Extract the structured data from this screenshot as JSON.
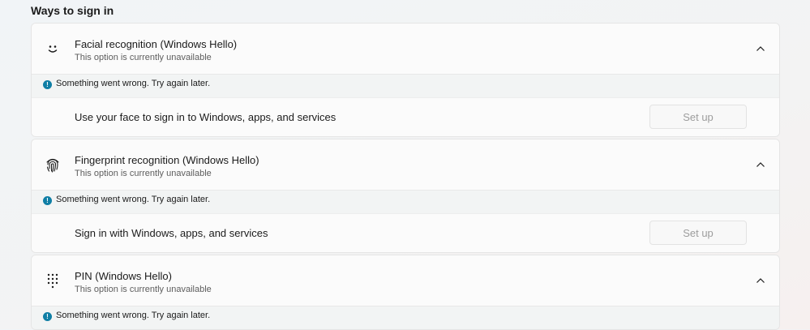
{
  "section": {
    "title": "Ways to sign in"
  },
  "cards": [
    {
      "icon": "smile-face-icon",
      "title": "Facial recognition (Windows Hello)",
      "subtitle": "This option is currently unavailable",
      "error": "Something went wrong. Try again later.",
      "row_label": "Use your face to sign in to Windows, apps, and services",
      "button": "Set up",
      "expanded": true
    },
    {
      "icon": "fingerprint-icon",
      "title": "Fingerprint recognition (Windows Hello)",
      "subtitle": "This option is currently unavailable",
      "error": "Something went wrong. Try again later.",
      "row_label": "Sign in with Windows, apps, and services",
      "button": "Set up",
      "expanded": true
    },
    {
      "icon": "pin-keypad-icon",
      "title": "PIN (Windows Hello)",
      "subtitle": "This option is currently unavailable",
      "error": "Something went wrong. Try again later.",
      "expanded": true
    }
  ],
  "colors": {
    "info": "#0f7ea5",
    "card_bg": "#fbfbfb",
    "error_bg": "#f2f4f4"
  }
}
